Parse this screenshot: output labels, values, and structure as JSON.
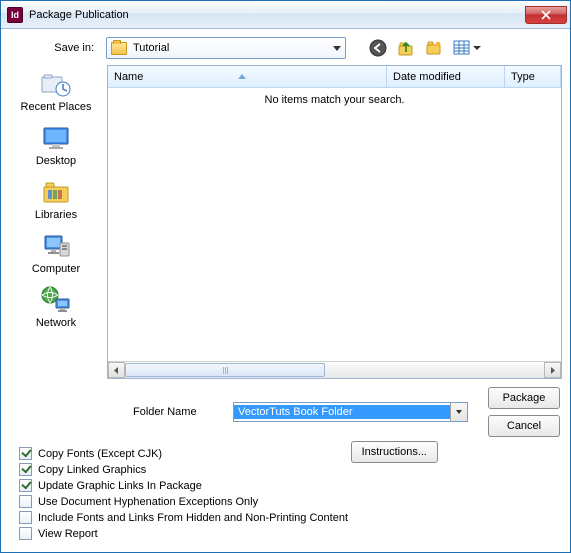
{
  "window": {
    "title": "Package Publication"
  },
  "labels": {
    "save_in": "Save in:",
    "folder_name": "Folder Name"
  },
  "location": {
    "value": "Tutorial"
  },
  "columns": {
    "name": "Name",
    "date": "Date modified",
    "type": "Type"
  },
  "empty_message": "No items match your search.",
  "folder_input": {
    "value": "VectorTuts Book Folder"
  },
  "buttons": {
    "package": "Package",
    "cancel": "Cancel",
    "instructions": "Instructions..."
  },
  "places": {
    "recent": "Recent Places",
    "desktop": "Desktop",
    "libraries": "Libraries",
    "computer": "Computer",
    "network": "Network"
  },
  "checkboxes": {
    "copy_fonts": {
      "label": "Copy Fonts (Except CJK)",
      "checked": true
    },
    "copy_linked": {
      "label": "Copy Linked Graphics",
      "checked": true
    },
    "update_links": {
      "label": "Update Graphic Links In Package",
      "checked": true
    },
    "hyphenation": {
      "label": "Use Document Hyphenation Exceptions Only",
      "checked": false
    },
    "hidden": {
      "label": "Include Fonts and Links From Hidden and Non-Printing Content",
      "checked": false
    },
    "report": {
      "label": "View Report",
      "checked": false
    }
  }
}
